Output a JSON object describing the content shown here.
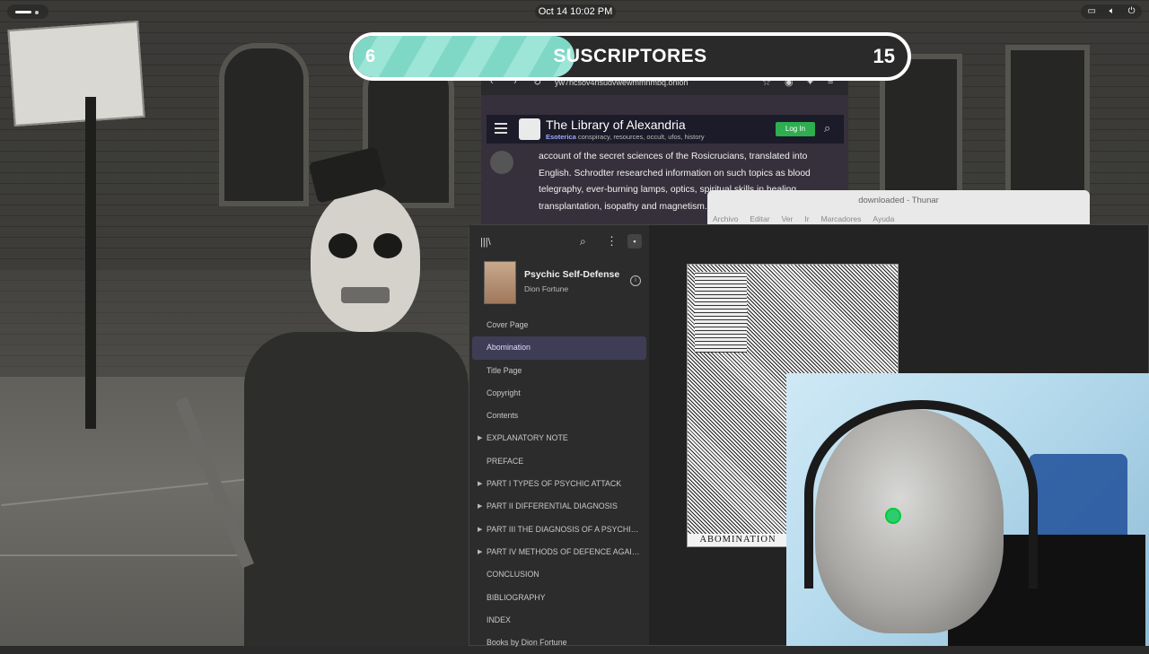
{
  "topbar": {
    "clock": "Oct 14  10:02 PM",
    "status_icons": [
      "window-icon",
      "volume-icon",
      "power-icon"
    ]
  },
  "subscribers": {
    "current": "6",
    "label": "SUSCRIPTORES",
    "goal": "15",
    "fill_fraction": 0.4,
    "fill_color": "#8fe0cf"
  },
  "browser": {
    "url": "yw7ricsov4nsudvwewmmnmbq.onion",
    "site_title": "The Library of Alexandria",
    "site_category": "Esoterica",
    "site_tags": "conspiracy, resources, occult, ufos, history",
    "login_label": "Log In",
    "post_text": "account of the secret sciences of the Rosicrucians, translated into English. Schrodter researched information on such topics as blood telegraphy, ever-burning lamps, optics, spiritual skills in healing, transplantation, isopathy and magnetism."
  },
  "thunar": {
    "title": "downloaded - Thunar",
    "menu": [
      "Archivo",
      "Editar",
      "Ver",
      "Ir",
      "Marcadores",
      "Ayuda"
    ]
  },
  "reader": {
    "book_title": "Psychic Self-Defense",
    "book_author": "Dion Fortune",
    "toc": [
      {
        "label": "Cover Page",
        "expandable": false,
        "active": false
      },
      {
        "label": "Abomination",
        "expandable": false,
        "active": true
      },
      {
        "label": "Title Page",
        "expandable": false,
        "active": false
      },
      {
        "label": "Copyright",
        "expandable": false,
        "active": false
      },
      {
        "label": "Contents",
        "expandable": false,
        "active": false
      },
      {
        "label": "EXPLANATORY NOTE",
        "expandable": true,
        "active": false
      },
      {
        "label": "PREFACE",
        "expandable": false,
        "active": false
      },
      {
        "label": "PART I TYPES OF PSYCHIC ATTACK",
        "expandable": true,
        "active": false
      },
      {
        "label": "PART II DIFFERENTIAL DIAGNOSIS",
        "expandable": true,
        "active": false
      },
      {
        "label": "PART III THE DIAGNOSIS OF A PSYCHIC A...",
        "expandable": true,
        "active": false
      },
      {
        "label": "PART IV METHODS OF DEFENCE AGAINS...",
        "expandable": true,
        "active": false
      },
      {
        "label": "CONCLUSION",
        "expandable": false,
        "active": false
      },
      {
        "label": "BIBLIOGRAPHY",
        "expandable": false,
        "active": false
      },
      {
        "label": "INDEX",
        "expandable": false,
        "active": false
      },
      {
        "label": "Books by Dion Fortune",
        "expandable": false,
        "active": false
      }
    ],
    "page_caption": "ABOMINATION"
  }
}
